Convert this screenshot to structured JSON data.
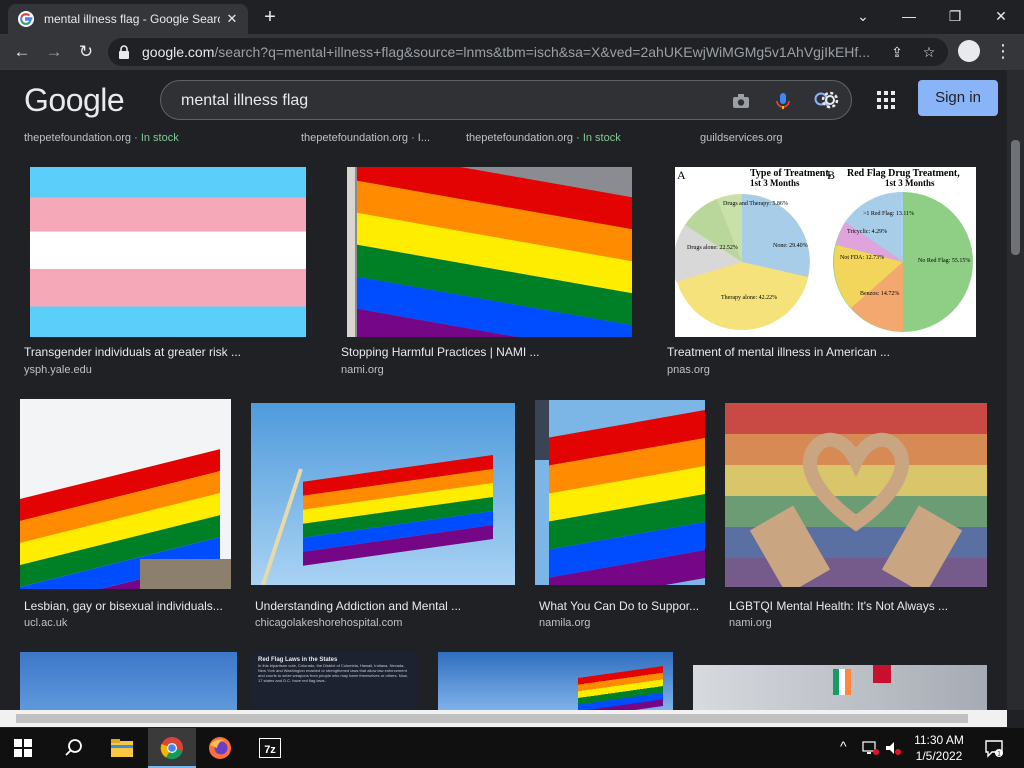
{
  "browser": {
    "tab_title": "mental illness flag - Google Search",
    "url_host": "google.com",
    "url_rest": "/search?q=mental+illness+flag&source=lnms&tbm=isch&sa=X&ved=2ahUKEwjWiMGMg5v1AhVgjIkEHf..."
  },
  "google": {
    "logo": "Google",
    "query": "mental illness flag",
    "signin_label": "Sign in"
  },
  "top_sources": [
    {
      "domain": "thepetefoundation.org",
      "suffix": " · ",
      "stock": "In stock"
    },
    {
      "domain": "thepetefoundation.org · I...",
      "suffix": "",
      "stock": ""
    },
    {
      "domain": "thepetefoundation.org",
      "suffix": " · ",
      "stock": "In stock"
    },
    {
      "domain": "guildservices.org",
      "suffix": "",
      "stock": ""
    }
  ],
  "results": [
    {
      "title": "Transgender individuals at greater risk ...",
      "source": "ysph.yale.edu"
    },
    {
      "title": "Stopping Harmful Practices | NAMI ...",
      "source": "nami.org"
    },
    {
      "title": "Treatment of mental illness in American ...",
      "source": "pnas.org"
    },
    {
      "title": "Lesbian, gay or bisexual individuals...",
      "source": "ucl.ac.uk"
    },
    {
      "title": "Understanding Addiction and Mental ...",
      "source": "chicagolakeshorehospital.com"
    },
    {
      "title": "What You Can Do to Suppor...",
      "source": "namila.org"
    },
    {
      "title": "LGBTQI Mental Health: It's Not Always ...",
      "source": "nami.org"
    }
  ],
  "pie_chart": {
    "label_a": "A",
    "label_b": "B",
    "title_a": "Type of Treatment,",
    "title_b": "Red Flag Drug Treatment,",
    "subtitle": "1st 3 Months",
    "a_slices": [
      "Drugs and Therapy: 5.86%",
      "None: 29.40%",
      "Drugs alone: 22.52%",
      "Therapy alone: 42.22%"
    ],
    "b_slices": [
      ">1 Red Flag: 13.11%",
      "Tricyclic: 4.29%",
      "Not FDA: 12.73%",
      "Benzos: 14.72%",
      "No Red Flag: 55.15%"
    ]
  },
  "red_flag_doc": {
    "heading": "Red Flag Laws in the States",
    "body": "In this bipartisan vote, Colorado, the District of Columbia, Hawaii, Indiana, Nevada, New York and Washington enacted or strengthened laws that allow law enforcement and courts to seize weapons from people who may harm themselves or others. Now, 17 states and D.C. have red flag laws."
  },
  "taskbar": {
    "time": "11:30 AM",
    "date": "1/5/2022"
  },
  "colors": {
    "page_bg": "#202124",
    "accent": "#8ab4f8",
    "in_stock": "#81c995"
  }
}
